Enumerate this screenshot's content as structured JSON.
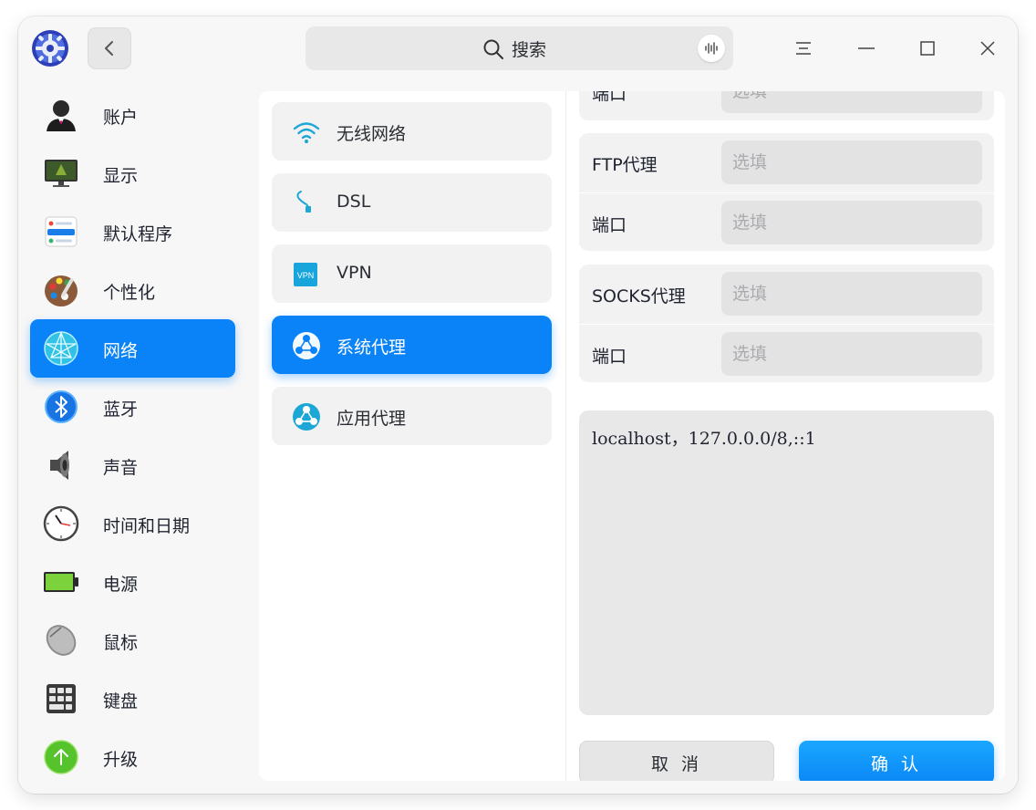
{
  "titlebar": {
    "search_placeholder": "搜索"
  },
  "sidebar": {
    "items": [
      {
        "label": "账户",
        "icon": "account-icon"
      },
      {
        "label": "显示",
        "icon": "display-icon"
      },
      {
        "label": "默认程序",
        "icon": "default-apps-icon"
      },
      {
        "label": "个性化",
        "icon": "personalization-icon"
      },
      {
        "label": "网络",
        "icon": "network-icon",
        "active": true
      },
      {
        "label": "蓝牙",
        "icon": "bluetooth-icon"
      },
      {
        "label": "声音",
        "icon": "sound-icon"
      },
      {
        "label": "时间和日期",
        "icon": "clock-icon"
      },
      {
        "label": "电源",
        "icon": "battery-icon"
      },
      {
        "label": "鼠标",
        "icon": "mouse-icon"
      },
      {
        "label": "键盘",
        "icon": "keyboard-icon"
      },
      {
        "label": "升级",
        "icon": "update-icon"
      }
    ]
  },
  "network": {
    "items": [
      {
        "label": "无线网络",
        "icon": "wifi-icon"
      },
      {
        "label": "DSL",
        "icon": "dsl-icon"
      },
      {
        "label": "VPN",
        "icon": "vpn-icon",
        "icon_text": "VPN"
      },
      {
        "label": "系统代理",
        "icon": "proxy-icon",
        "active": true
      },
      {
        "label": "应用代理",
        "icon": "app-proxy-icon"
      }
    ]
  },
  "proxy": {
    "partial_port_label": "端口",
    "ftp_label": "FTP代理",
    "socks_label": "SOCKS代理",
    "port_label": "端口",
    "placeholder": "选填",
    "ignore_hosts": "localhost，127.0.0.0/8,::1",
    "cancel_label": "取 消",
    "confirm_label": "确 认"
  },
  "colors": {
    "accent": "#0a83f8",
    "window_bg": "#f7f7f7",
    "field_bg": "#e3e3e3"
  }
}
